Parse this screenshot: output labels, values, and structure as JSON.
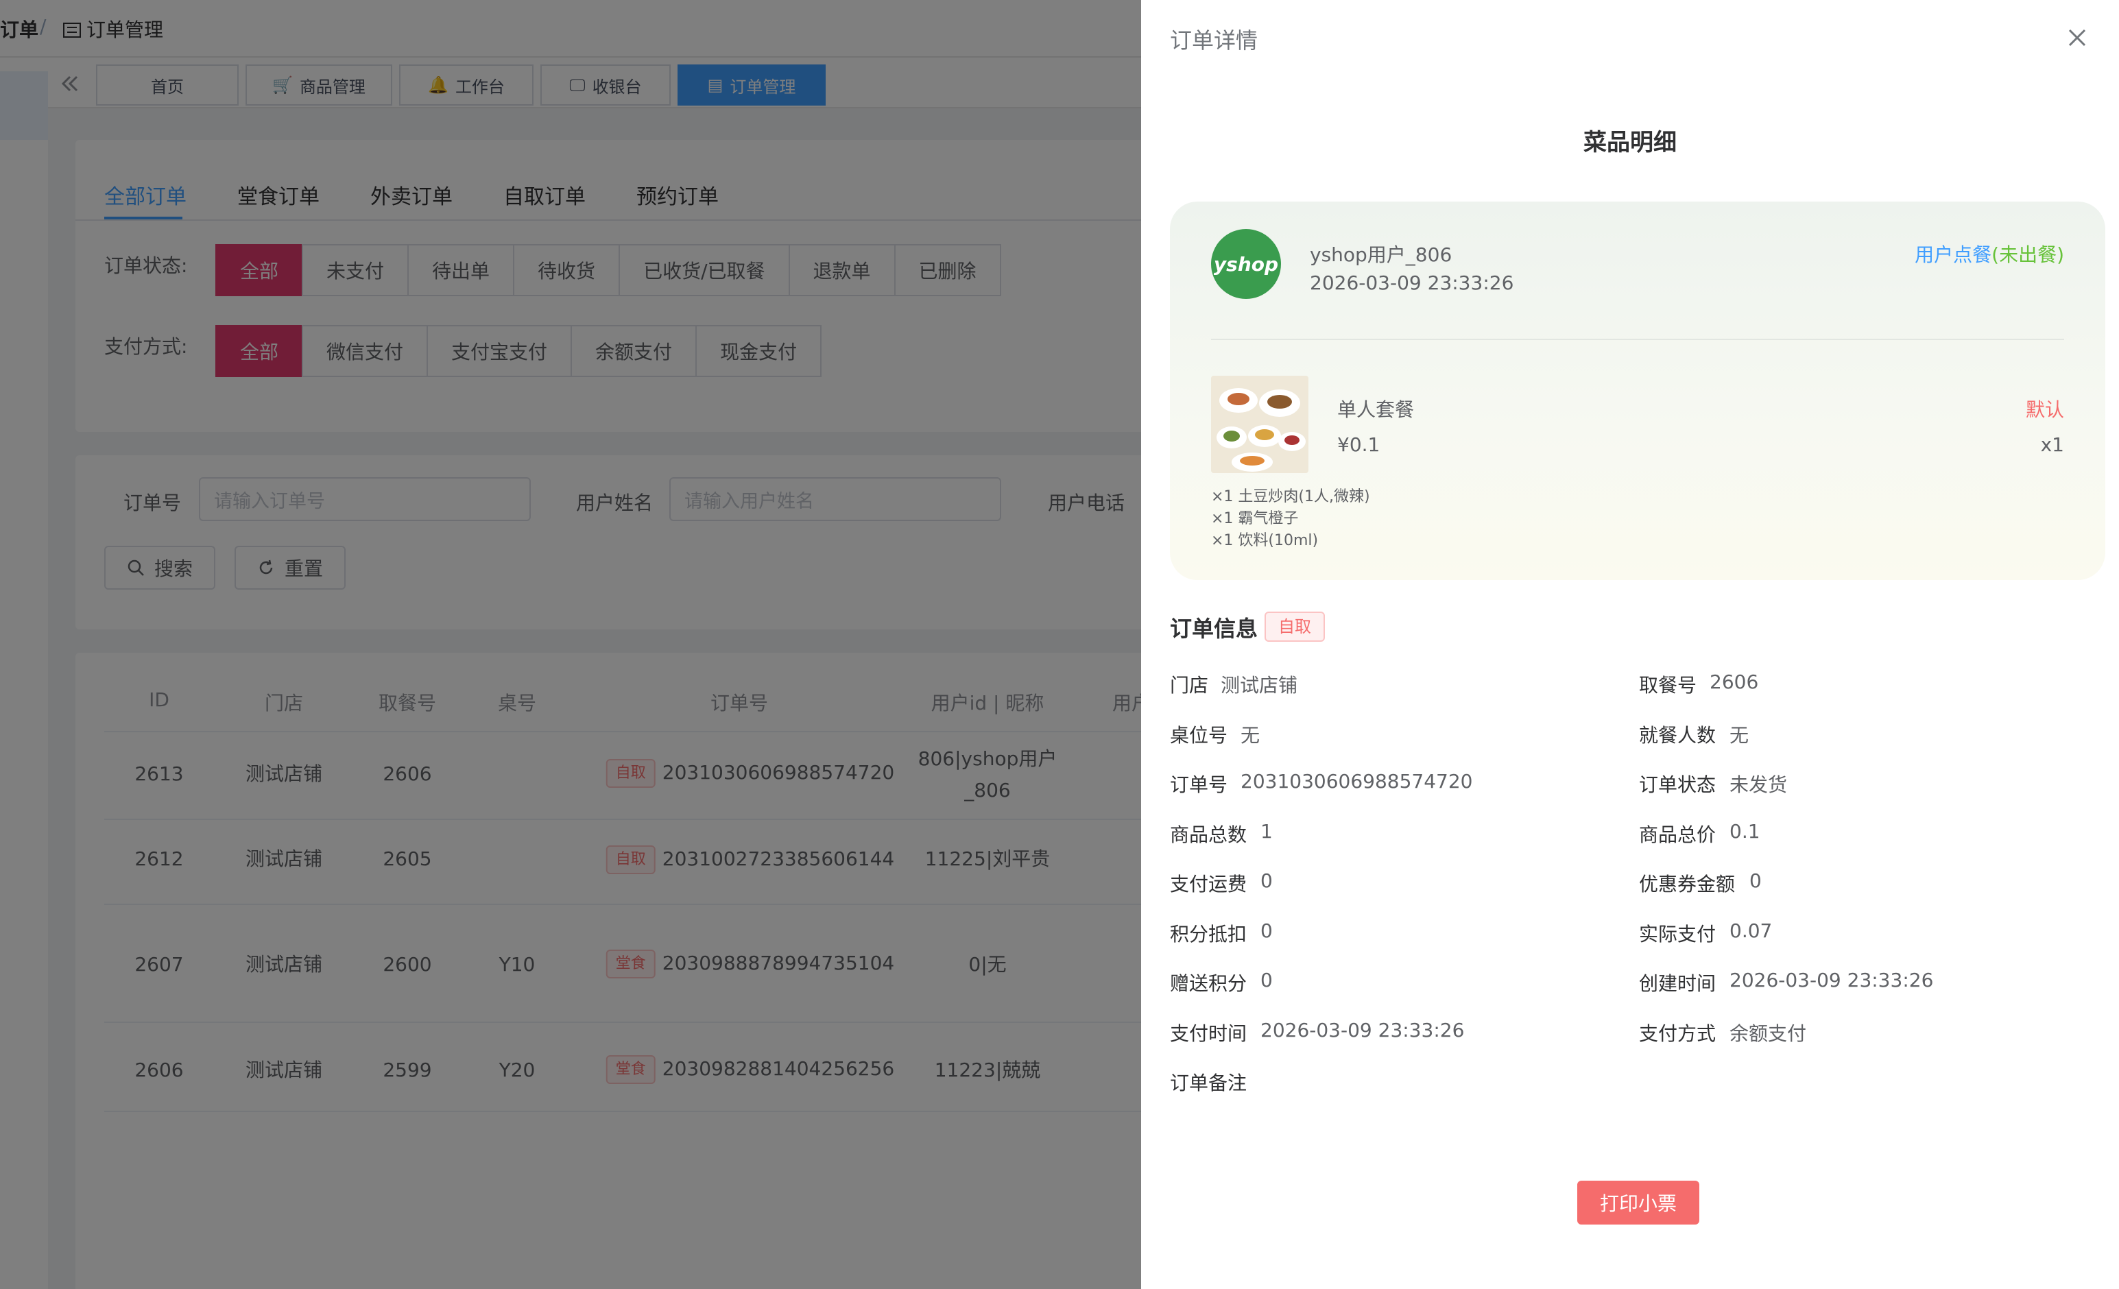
{
  "breadcrumb": {
    "first": "订单",
    "sep": "/",
    "current": "订单管理"
  },
  "tags_view": {
    "tabs": [
      {
        "label": "首页"
      },
      {
        "label": "商品管理"
      },
      {
        "label": "工作台"
      },
      {
        "label": "收银台"
      },
      {
        "label": "订单管理"
      }
    ]
  },
  "order_tabs": [
    "全部订单",
    "堂食订单",
    "外卖订单",
    "自取订单",
    "预约订单"
  ],
  "filters": {
    "status_label": "订单状态:",
    "status_options": [
      "全部",
      "未支付",
      "待出单",
      "待收货",
      "已收货/已取餐",
      "退款单",
      "已删除"
    ],
    "pay_label": "支付方式:",
    "pay_options": [
      "全部",
      "微信支付",
      "支付宝支付",
      "余额支付",
      "现金支付"
    ]
  },
  "search": {
    "order_no_label": "订单号",
    "order_no_placeholder": "请输入订单号",
    "user_name_label": "用户姓名",
    "user_name_placeholder": "请输入用户姓名",
    "user_phone_label": "用户电话",
    "search_btn": "搜索",
    "reset_btn": "重置"
  },
  "table": {
    "headers": [
      "ID",
      "门店",
      "取餐号",
      "桌号",
      "订单号",
      "用户id | 昵称",
      "用户"
    ],
    "rows": [
      {
        "id": "2613",
        "store": "测试店铺",
        "pickup": "2606",
        "table": "",
        "type": "自取",
        "order_no": "2031030606988574720",
        "user": "806|yshop用户",
        "user2": "_806"
      },
      {
        "id": "2612",
        "store": "测试店铺",
        "pickup": "2605",
        "table": "",
        "type": "自取",
        "order_no": "2031002723385606144",
        "user": "11225|刘平贵",
        "user2": ""
      },
      {
        "id": "2607",
        "store": "测试店铺",
        "pickup": "2600",
        "table": "Y10",
        "type": "堂食",
        "order_no": "2030988878994735104",
        "user": "0|无",
        "user2": ""
      },
      {
        "id": "2606",
        "store": "测试店铺",
        "pickup": "2599",
        "table": "Y20",
        "type": "堂食",
        "order_no": "2030982881404256256",
        "user": "11223|兢兢",
        "user2": ""
      }
    ]
  },
  "drawer": {
    "title": "订单详情",
    "section_title": "菜品明细",
    "user": {
      "logo_text": "yshop",
      "name": "yshop用户_806",
      "time": "2026-03-09 23:33:26",
      "status_a": "用户点餐",
      "status_b": "(未出餐)"
    },
    "item": {
      "name": "单人套餐",
      "price": "¥0.1",
      "spec": "默认",
      "qty": "x1",
      "subs": [
        "×1 土豆炒肉(1人,微辣)",
        "×1 霸气橙子",
        "×1 饮料(10ml)"
      ]
    },
    "info_title": "订单信息",
    "info_badge": "自取",
    "info_left": [
      {
        "k": "门店",
        "v": "测试店铺"
      },
      {
        "k": "桌位号",
        "v": "无"
      },
      {
        "k": "订单号",
        "v": "2031030606988574720"
      },
      {
        "k": "商品总数",
        "v": "1"
      },
      {
        "k": "支付运费",
        "v": "0"
      },
      {
        "k": "积分抵扣",
        "v": "0"
      },
      {
        "k": "赠送积分",
        "v": "0"
      },
      {
        "k": "支付时间",
        "v": "2026-03-09 23:33:26"
      },
      {
        "k": "订单备注",
        "v": ""
      }
    ],
    "info_right": [
      {
        "k": "取餐号",
        "v": "2606"
      },
      {
        "k": "就餐人数",
        "v": "无"
      },
      {
        "k": "订单状态",
        "v": "未发货"
      },
      {
        "k": "商品总价",
        "v": "0.1"
      },
      {
        "k": "优惠券金额",
        "v": "0"
      },
      {
        "k": "实际支付",
        "v": "0.07"
      },
      {
        "k": "创建时间",
        "v": "2026-03-09 23:33:26"
      },
      {
        "k": "支付方式",
        "v": "余额支付"
      }
    ],
    "print_btn": "打印小票"
  },
  "colors": {
    "primary": "#409eff",
    "danger": "#f56c6c",
    "accent": "#e33a6f",
    "success": "#67c23a"
  }
}
